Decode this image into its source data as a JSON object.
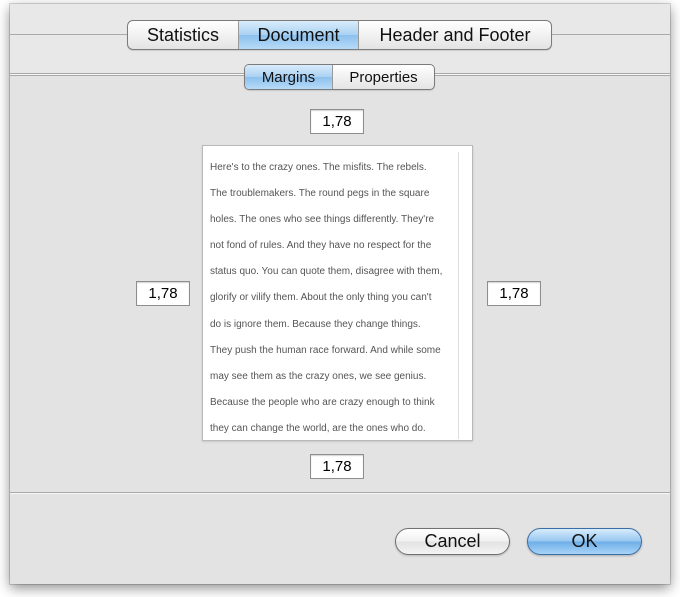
{
  "tabs": {
    "main": [
      {
        "label": "Statistics",
        "selected": false
      },
      {
        "label": "Document",
        "selected": true
      },
      {
        "label": "Header and Footer",
        "selected": false
      }
    ],
    "sub": [
      {
        "label": "Margins",
        "selected": true
      },
      {
        "label": "Properties",
        "selected": false
      }
    ]
  },
  "margins": {
    "top": "1,78",
    "left": "1,78",
    "right": "1,78",
    "bottom": "1,78"
  },
  "preview": {
    "lines": [
      "Here's to the crazy ones. The misfits.  The rebels.",
      "The troublemakers. The round pegs in the square",
      "holes. The ones who see things differently. They're",
      "not fond of rules. And they have no respect for the",
      "status quo. You can quote them, disagree with them,",
      "glorify or vilify them. About the only thing you can't",
      "do is ignore them. Because they change things.",
      "They push the human race forward. And while some",
      "may see them as the crazy ones, we see genius.",
      "Because the people who are crazy enough to think",
      "they can change the world, are the ones who do."
    ]
  },
  "buttons": {
    "cancel": "Cancel",
    "ok": "OK"
  },
  "colors": {
    "selected_segment": "#a9d1f3",
    "default_button": "#6eaee8",
    "window_background": "#e3e3e3"
  }
}
